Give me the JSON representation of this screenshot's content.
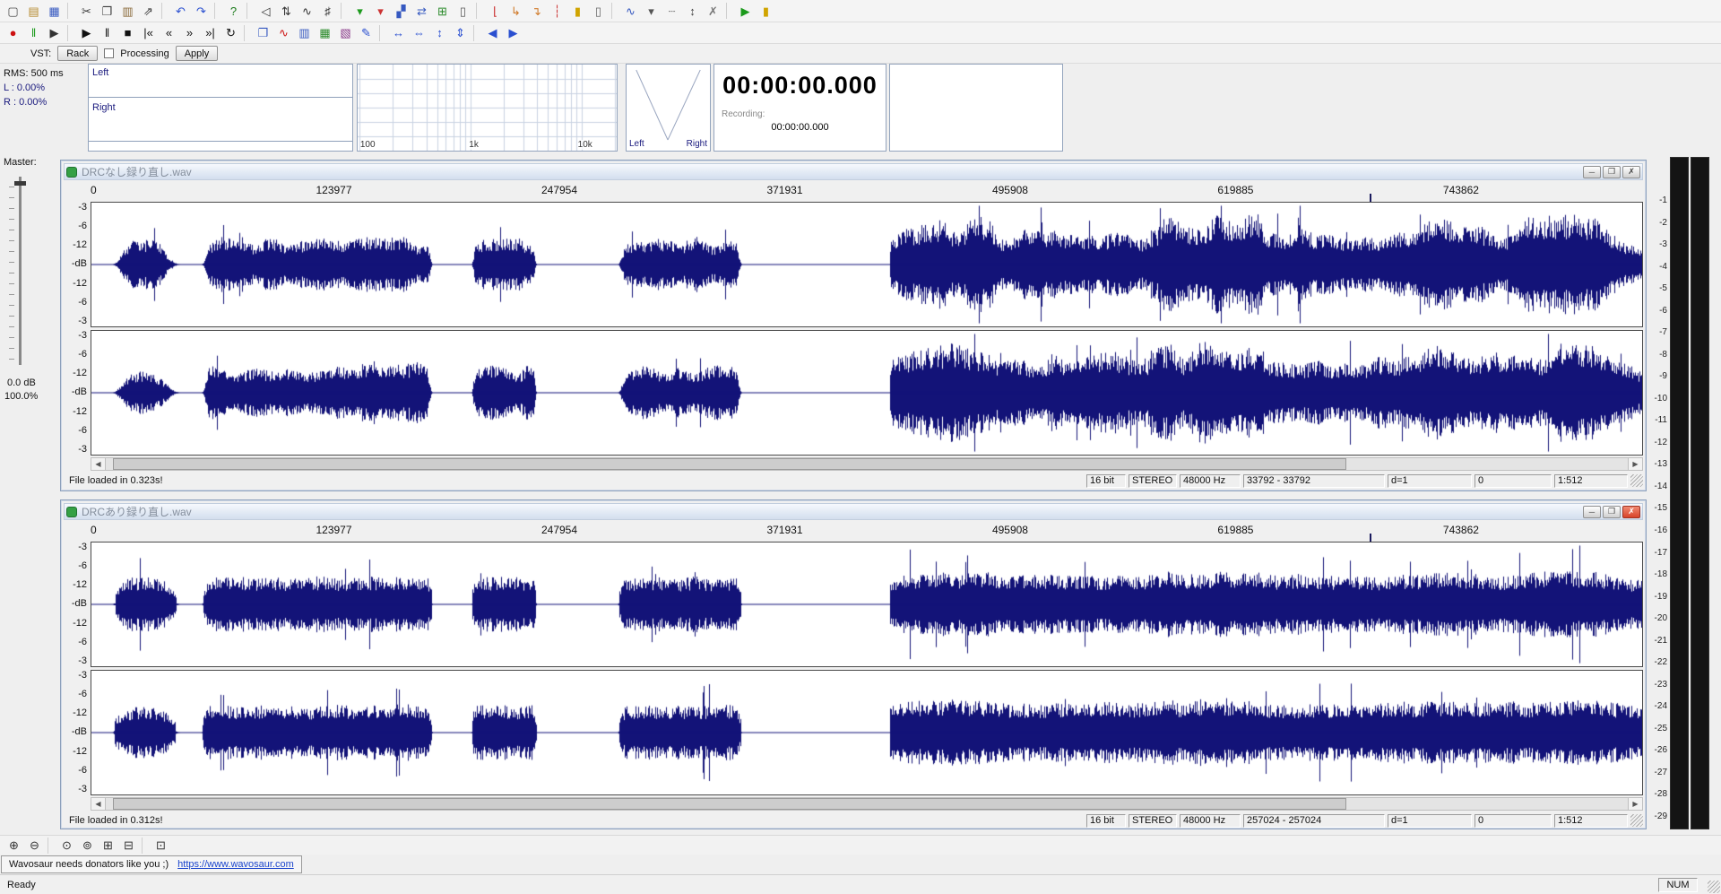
{
  "toolbar1": {
    "icons": [
      {
        "name": "new-icon",
        "glyph": "▢",
        "color": "#4a4a4a"
      },
      {
        "name": "open-icon",
        "glyph": "▤",
        "color": "#b58a2e"
      },
      {
        "name": "save-icon",
        "glyph": "▦",
        "color": "#3558c0"
      },
      {
        "sep": true
      },
      {
        "name": "cut-icon",
        "glyph": "✂",
        "color": "#3a3a3a"
      },
      {
        "name": "copy-icon",
        "glyph": "❐",
        "color": "#3a3a3a"
      },
      {
        "name": "paste-icon",
        "glyph": "▥",
        "color": "#8a6a3a"
      },
      {
        "name": "paste-new-icon",
        "glyph": "⇗",
        "color": "#3a3a3a"
      },
      {
        "sep": true
      },
      {
        "name": "undo-icon",
        "glyph": "↶",
        "color": "#2a4fd0"
      },
      {
        "name": "redo-icon",
        "glyph": "↷",
        "color": "#2a4fd0"
      },
      {
        "sep": true
      },
      {
        "name": "help-icon",
        "glyph": "?",
        "color": "#1a7a1a"
      },
      {
        "sep": true
      },
      {
        "name": "volume-icon",
        "glyph": "◁",
        "color": "#333333"
      },
      {
        "name": "channel-mix-icon",
        "glyph": "⇅",
        "color": "#333333"
      },
      {
        "name": "resample-icon",
        "glyph": "∿",
        "color": "#333333"
      },
      {
        "name": "pitch-icon",
        "glyph": "♯",
        "color": "#333333"
      },
      {
        "sep": true
      },
      {
        "name": "marker-add-icon",
        "glyph": "▾",
        "color": "#1c9a1c"
      },
      {
        "name": "marker-delete-icon",
        "glyph": "▾",
        "color": "#cc3333"
      },
      {
        "name": "region-icon",
        "glyph": "▞",
        "color": "#3558c0"
      },
      {
        "name": "loop-selection-icon",
        "glyph": "⇄",
        "color": "#3558c0"
      },
      {
        "name": "snap-grid-icon",
        "glyph": "⊞",
        "color": "#2a8a2a"
      },
      {
        "name": "bin-icon",
        "glyph": "▯",
        "color": "#555555"
      },
      {
        "sep": true
      },
      {
        "name": "cue-point-icon",
        "glyph": "⌊",
        "color": "#cc3333"
      },
      {
        "name": "cue-prev-icon",
        "glyph": "↳",
        "color": "#d07a2a"
      },
      {
        "name": "cue-next-icon",
        "glyph": "↴",
        "color": "#d07a2a"
      },
      {
        "name": "marker-line-icon",
        "glyph": "┆",
        "color": "#cc3333"
      },
      {
        "name": "lock-icon",
        "glyph": "▮",
        "color": "#d0a400"
      },
      {
        "name": "trash-icon",
        "glyph": "▯",
        "color": "#666666"
      },
      {
        "sep": true
      },
      {
        "name": "envelope-icon",
        "glyph": "∿",
        "color": "#3558c0"
      },
      {
        "name": "dropdown-icon",
        "glyph": "▾",
        "color": "#555555"
      },
      {
        "name": "dashes-icon",
        "glyph": "┄",
        "color": "#888888"
      },
      {
        "name": "updown-icon",
        "glyph": "↕",
        "color": "#444444"
      },
      {
        "name": "clear-vst-icon",
        "glyph": "✗",
        "color": "#777777"
      },
      {
        "sep": true
      },
      {
        "name": "vst-play-icon",
        "glyph": "▶",
        "color": "#1c9a1c"
      },
      {
        "name": "lock2-icon",
        "glyph": "▮",
        "color": "#d0a400"
      }
    ]
  },
  "toolbar2": {
    "icons": [
      {
        "name": "record-icon",
        "glyph": "●",
        "color": "#cc1111"
      },
      {
        "name": "pause-alt-icon",
        "glyph": "‖",
        "color": "#1c9a1c"
      },
      {
        "name": "play-cursor-icon",
        "glyph": "▶",
        "color": "#333333"
      },
      {
        "sep": true
      },
      {
        "name": "play-icon",
        "glyph": "▶",
        "color": "#111111"
      },
      {
        "name": "pause-icon",
        "glyph": "‖",
        "color": "#111111"
      },
      {
        "name": "stop-icon",
        "glyph": "■",
        "color": "#111111"
      },
      {
        "name": "go-start-icon",
        "glyph": "|«",
        "color": "#111111"
      },
      {
        "name": "rewind-icon",
        "glyph": "«",
        "color": "#111111"
      },
      {
        "name": "forward-icon",
        "glyph": "»",
        "color": "#111111"
      },
      {
        "name": "go-end-icon",
        "glyph": "»|",
        "color": "#111111"
      },
      {
        "name": "loop-icon",
        "glyph": "↻",
        "color": "#111111"
      },
      {
        "sep": true
      },
      {
        "name": "copy-view-icon",
        "glyph": "❐",
        "color": "#3558c0"
      },
      {
        "name": "statistics-icon",
        "glyph": "∿",
        "color": "#cc1111"
      },
      {
        "name": "spectrum-view-icon",
        "glyph": "▥",
        "color": "#3558c0"
      },
      {
        "name": "grid-view-icon",
        "glyph": "▦",
        "color": "#2a8a2a"
      },
      {
        "name": "sonogram-icon",
        "glyph": "▧",
        "color": "#8a3a8a"
      },
      {
        "name": "draw-icon",
        "glyph": "✎",
        "color": "#2a4fd0"
      },
      {
        "sep": true
      },
      {
        "name": "zoom-h-in-icon",
        "glyph": "↔",
        "color": "#2a4fd0"
      },
      {
        "name": "zoom-h-out-icon",
        "glyph": "⇔",
        "color": "#2a4fd0"
      },
      {
        "name": "zoom-v-in-icon",
        "glyph": "↕",
        "color": "#2a4fd0"
      },
      {
        "name": "zoom-v-out-icon",
        "glyph": "⇕",
        "color": "#2a4fd0"
      },
      {
        "sep": true
      },
      {
        "name": "prev-view-icon",
        "glyph": "◀",
        "color": "#2a4fd0"
      },
      {
        "name": "next-view-icon",
        "glyph": "▶",
        "color": "#2a4fd0"
      }
    ]
  },
  "vst": {
    "label": "VST:",
    "rack": "Rack",
    "processing": "Processing",
    "apply": "Apply"
  },
  "rms": {
    "title": "RMS: 500 ms",
    "left": "L : 0.00%",
    "right": "R : 0.00%"
  },
  "meters": {
    "left": "Left",
    "right": "Right"
  },
  "spectrum": {
    "ticks": [
      "100",
      "1k",
      "10k"
    ]
  },
  "gonio": {
    "left": "Left",
    "right": "Right"
  },
  "time": {
    "main": "00:00:00.000",
    "recording_label": "Recording:",
    "recording_value": "00:00:00.000"
  },
  "master": {
    "label": "Master:",
    "gain_db": "0.0 dB",
    "percent": "100.0%"
  },
  "db_labels": [
    "-3",
    "-6",
    "-12",
    "-dB",
    "-12",
    "-6",
    "-3"
  ],
  "scrollbar": {
    "left": "◀",
    "right": "▶"
  },
  "window_controls": {
    "minimize": "─",
    "maximize": "❐",
    "close": "✗"
  },
  "windows": [
    {
      "title": "DRCなし録り直し.wav",
      "ruler": [
        "0",
        "123977",
        "247954",
        "371931",
        "495908",
        "619885",
        "743862"
      ],
      "status": "File loaded in 0.323s!",
      "cells": [
        "16 bit",
        "STEREO",
        "48000 Hz",
        "33792 - 33792",
        "d=1",
        "0",
        "1:512"
      ]
    },
    {
      "title": "DRCあり録り直し.wav",
      "ruler": [
        "0",
        "123977",
        "247954",
        "371931",
        "495908",
        "619885",
        "743862"
      ],
      "status": "File loaded in 0.312s!",
      "cells": [
        "16 bit",
        "STEREO",
        "48000 Hz",
        "257024 - 257024",
        "d=1",
        "0",
        "1:512"
      ]
    }
  ],
  "right_scale": {
    "values": [
      "-1",
      "-2",
      "-3",
      "-4",
      "-5",
      "-6",
      "-7",
      "-8",
      "-9",
      "-10",
      "-11",
      "-12",
      "-13",
      "-14",
      "-15",
      "-16",
      "-17",
      "-18",
      "-19",
      "-20",
      "-21",
      "-22",
      "-23",
      "-24",
      "-25",
      "-26",
      "-27",
      "-28",
      "-29"
    ]
  },
  "zoombar": {
    "icons": [
      {
        "name": "zoom-in-icon",
        "glyph": "⊕",
        "color": "#333333"
      },
      {
        "name": "zoom-out-icon",
        "glyph": "⊖",
        "color": "#333333"
      },
      {
        "sep": true
      },
      {
        "name": "zoom-selection-icon",
        "glyph": "⊙",
        "color": "#333333"
      },
      {
        "name": "zoom-all-icon",
        "glyph": "⊚",
        "color": "#333333"
      },
      {
        "name": "zoom-vertical-in-icon",
        "glyph": "⊞",
        "color": "#333333"
      },
      {
        "name": "zoom-vertical-out-icon",
        "glyph": "⊟",
        "color": "#333333"
      },
      {
        "sep": true
      },
      {
        "name": "zoom-reset-icon",
        "glyph": "⊡",
        "color": "#333333"
      }
    ]
  },
  "donation": {
    "text": "Wavosaur needs donators like you ;)",
    "url": "https://www.wavosaur.com"
  },
  "statusbar": {
    "ready": "Ready",
    "num": "NUM"
  }
}
